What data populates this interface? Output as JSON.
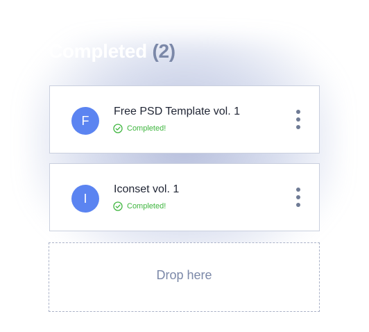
{
  "column": {
    "title": "Completed",
    "count": "(2)"
  },
  "cards": [
    {
      "avatar_letter": "F",
      "title": "Free PSD Template vol. 1",
      "status_text": "Completed!",
      "status_icon": "check-circle-icon",
      "menu_icon": "kebab-menu-icon"
    },
    {
      "avatar_letter": "I",
      "title": "Iconset vol. 1",
      "status_text": "Completed!",
      "status_icon": "check-circle-icon",
      "menu_icon": "kebab-menu-icon"
    }
  ],
  "dropzone": {
    "label": "Drop here"
  },
  "colors": {
    "avatar": "#5b84f1",
    "success": "#3db53d",
    "muted": "#7b88a8",
    "card_border": "#c9cfde"
  }
}
